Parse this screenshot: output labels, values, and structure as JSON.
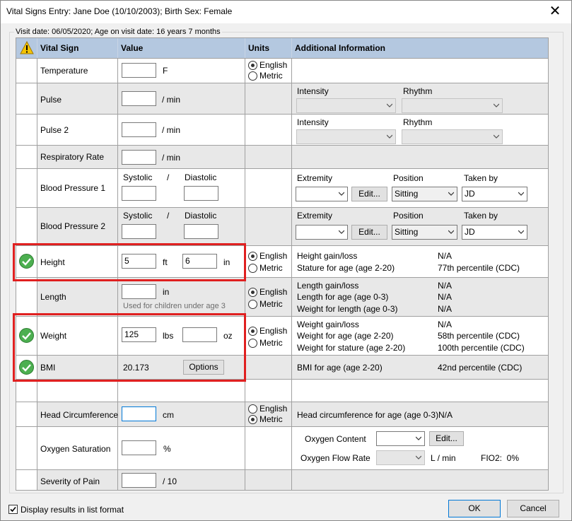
{
  "window": {
    "title": "Vital Signs Entry: Jane Doe (10/10/2003); Birth Sex: Female",
    "visit_line": "Visit date: 06/05/2020; Age on visit date: 16 years 7 months"
  },
  "header": {
    "vital_sign": "Vital Sign",
    "value": "Value",
    "units": "Units",
    "additional": "Additional Information"
  },
  "units": {
    "english": "English",
    "metric": "Metric"
  },
  "rows": {
    "temperature": {
      "label": "Temperature",
      "unit": "F",
      "value": ""
    },
    "pulse": {
      "label": "Pulse",
      "unit": "/ min",
      "value": "",
      "intensity_label": "Intensity",
      "rhythm_label": "Rhythm"
    },
    "pulse2": {
      "label": "Pulse 2",
      "unit": "/ min",
      "value": "",
      "intensity_label": "Intensity",
      "rhythm_label": "Rhythm"
    },
    "respiratory": {
      "label": "Respiratory Rate",
      "unit": "/ min",
      "value": ""
    },
    "bp1": {
      "label": "Blood Pressure 1",
      "systolic": "Systolic",
      "slash": "/",
      "diastolic": "Diastolic",
      "extremity_label": "Extremity",
      "position_label": "Position",
      "takenby_label": "Taken by",
      "edit": "Edit...",
      "position": "Sitting",
      "takenby": "JD"
    },
    "bp2": {
      "label": "Blood Pressure 2",
      "systolic": "Systolic",
      "slash": "/",
      "diastolic": "Diastolic",
      "extremity_label": "Extremity",
      "position_label": "Position",
      "takenby_label": "Taken by",
      "edit": "Edit...",
      "position": "Sitting",
      "takenby": "JD"
    },
    "height": {
      "label": "Height",
      "ft_value": "5",
      "ft_unit": "ft",
      "in_value": "6",
      "in_unit": "in",
      "info1_label": "Height gain/loss",
      "info1_value": "N/A",
      "info2_label": "Stature for age (age 2-20)",
      "info2_value": "77th percentile (CDC)"
    },
    "length": {
      "label": "Length",
      "unit": "in",
      "hint": "Used for children under age 3",
      "info1_label": "Length gain/loss",
      "info1_value": "N/A",
      "info2_label": "Length for age (age 0-3)",
      "info2_value": "N/A",
      "info3_label": "Weight for length (age 0-3)",
      "info3_value": "N/A"
    },
    "weight": {
      "label": "Weight",
      "lbs_value": "125",
      "lbs_unit": "lbs",
      "oz_value": "",
      "oz_unit": "oz",
      "info1_label": "Weight gain/loss",
      "info1_value": "N/A",
      "info2_label": "Weight for age (age 2-20)",
      "info2_value": "58th percentile (CDC)",
      "info3_label": "Weight for stature (age 2-20)",
      "info3_value": "100th percentile (CDC)"
    },
    "bmi": {
      "label": "BMI",
      "value": "20.173",
      "options": "Options",
      "info1_label": "BMI for age (age 2-20)",
      "info1_value": "42nd percentile (CDC)"
    },
    "head": {
      "label": "Head Circumference",
      "unit": "cm",
      "info1_label": "Head circumference for age (age 0-3)",
      "info1_value": "N/A"
    },
    "oxygen": {
      "label": "Oxygen Saturation",
      "unit": "%",
      "content_label": "Oxygen Content",
      "edit": "Edit...",
      "flow_label": "Oxygen Flow Rate",
      "flow_unit": "L / min",
      "fio2": "FIO2:  0%"
    },
    "pain": {
      "label": "Severity of Pain",
      "unit": "/ 10"
    }
  },
  "footer": {
    "display_list": "Display results in list format",
    "ok": "OK",
    "cancel": "Cancel"
  },
  "colors": {
    "header": "#b4c8e0",
    "highlight": "#e02020",
    "ok_icon": "#4caf50"
  }
}
